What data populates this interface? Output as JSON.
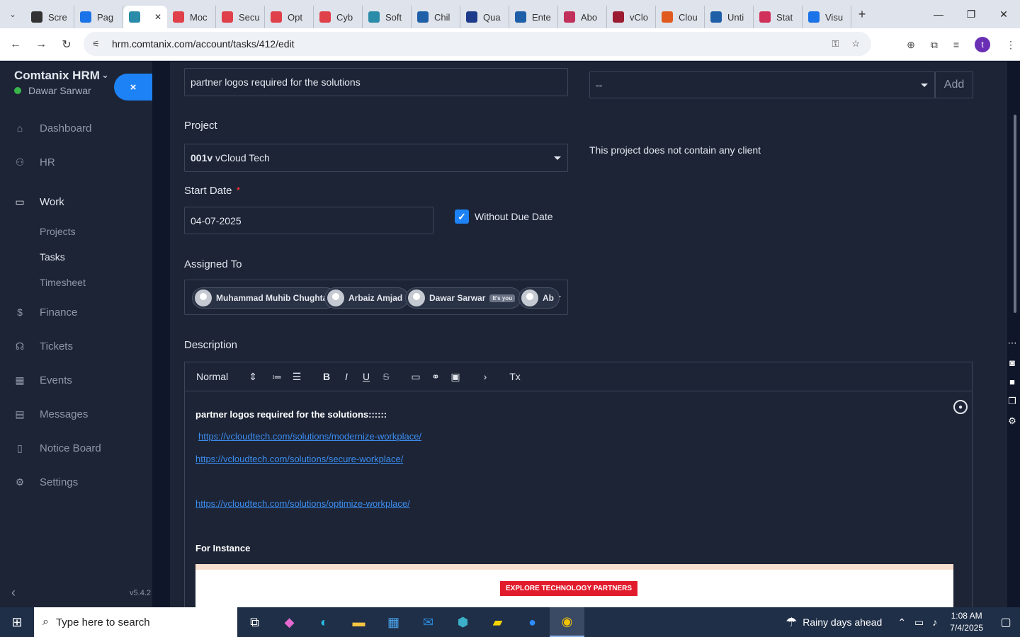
{
  "browser": {
    "tabs": [
      {
        "label": "Scre",
        "color": "#333333"
      },
      {
        "label": "Pag",
        "color": "#1a73e8"
      },
      {
        "label": "",
        "color": "#2a8ca8"
      },
      {
        "label": "Moc",
        "color": "#e0404a"
      },
      {
        "label": "Secu",
        "color": "#e0404a"
      },
      {
        "label": "Opt",
        "color": "#e0404a"
      },
      {
        "label": "Cyb",
        "color": "#e0404a"
      },
      {
        "label": "Soft",
        "color": "#2a8ca8"
      },
      {
        "label": "Chil",
        "color": "#1e5fa8"
      },
      {
        "label": "Qua",
        "color": "#1e3a8a"
      },
      {
        "label": "Ente",
        "color": "#1e5fa8"
      },
      {
        "label": "Abo",
        "color": "#c0305a"
      },
      {
        "label": "vClo",
        "color": "#9b1b30"
      },
      {
        "label": "Clou",
        "color": "#e05a20"
      },
      {
        "label": "Unti",
        "color": "#1e5fa8"
      },
      {
        "label": "Stat",
        "color": "#d0305a"
      },
      {
        "label": "Visu",
        "color": "#1a73e8"
      }
    ],
    "url": "hrm.comtanix.com/account/tasks/412/edit",
    "profile_initial": "t"
  },
  "sidebar": {
    "brand": "Comtanix HRM",
    "user": "Dawar Sarwar",
    "close_label": "×",
    "items": [
      {
        "label": "Dashboard",
        "icon": "home-icon",
        "glyph": "⌂"
      },
      {
        "label": "HR",
        "icon": "users-icon",
        "glyph": "⚇"
      },
      {
        "label": "Work",
        "icon": "briefcase-icon",
        "glyph": "▭"
      }
    ],
    "work_sub": [
      "Projects",
      "Tasks",
      "Timesheet"
    ],
    "items_after": [
      {
        "label": "Finance",
        "icon": "dollar-icon",
        "glyph": "$"
      },
      {
        "label": "Tickets",
        "icon": "headset-icon",
        "glyph": "☊"
      },
      {
        "label": "Events",
        "icon": "calendar-icon",
        "glyph": "▦"
      },
      {
        "label": "Messages",
        "icon": "message-icon",
        "glyph": "▤"
      },
      {
        "label": "Notice Board",
        "icon": "clipboard-icon",
        "glyph": "▯"
      },
      {
        "label": "Settings",
        "icon": "gear-icon",
        "glyph": "⚙"
      }
    ],
    "collapse_icon": "‹",
    "version": "v5.4.2"
  },
  "form": {
    "title_value": "partner logos required for the solutions",
    "label_select_value": "--",
    "add_label": "Add",
    "project_label": "Project",
    "project_code": "001v",
    "project_name": "vCloud Tech",
    "no_client_text": "This project does not contain any client",
    "start_date_label": "Start Date",
    "required_mark": "*",
    "start_date_value": "04-07-2025",
    "without_due_date_label": "Without Due Date",
    "assigned_label": "Assigned To",
    "assignees": [
      {
        "name": "Muhammad Muhib Chughtai"
      },
      {
        "name": "Arbaiz Amjad"
      },
      {
        "name": "Dawar Sarwar",
        "badge": "It's you"
      },
      {
        "name": "Ab"
      }
    ],
    "description_label": "Description"
  },
  "editor": {
    "format_select": "Normal",
    "toolbar": [
      {
        "name": "ordered-list-icon",
        "glyph": "≔"
      },
      {
        "name": "bullet-list-icon",
        "glyph": "☰"
      },
      {
        "name": "bold-icon",
        "glyph": "B"
      },
      {
        "name": "italic-icon",
        "glyph": "I"
      },
      {
        "name": "underline-icon",
        "glyph": "U"
      },
      {
        "name": "strike-icon",
        "glyph": "S"
      },
      {
        "name": "image-icon",
        "glyph": "▭"
      },
      {
        "name": "link-icon",
        "glyph": "⚭"
      },
      {
        "name": "video-icon",
        "glyph": "▣"
      },
      {
        "name": "indent-icon",
        "glyph": "›"
      },
      {
        "name": "clear-format-icon",
        "glyph": "Tx"
      }
    ],
    "line1": "partner logos required for the solutions::::::",
    "link1": "https://vcloudtech.com/solutions/modernize-workplace/",
    "link2": "https://vcloudtech.com/solutions/secure-workplace/",
    "link3": "https://vcloudtech.com/solutions/optimize-workplace/",
    "for_instance": "For Instance",
    "image_button_text": "EXPLORE TECHNOLOGY PARTNERS"
  },
  "taskbar": {
    "search_placeholder": "Type here to search",
    "weather": "Rainy days ahead",
    "time": "1:08 AM",
    "date": "7/4/2025"
  }
}
